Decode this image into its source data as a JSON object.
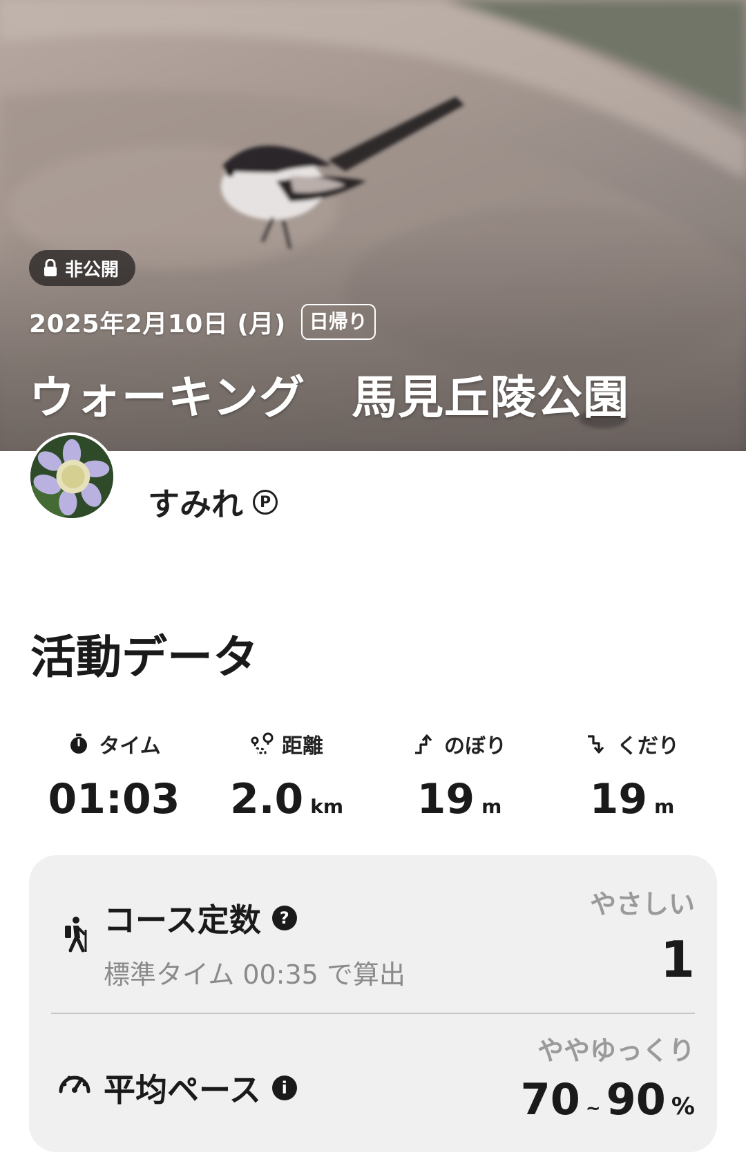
{
  "hero": {
    "privacy_label": "非公開",
    "date": "2025年2月10日 (月)",
    "trip_type": "日帰り",
    "title": "ウォーキング　馬見丘陵公園"
  },
  "user": {
    "name": "すみれ",
    "premium_mark": "P"
  },
  "activity": {
    "section_title": "活動データ",
    "stats": [
      {
        "icon": "stopwatch-icon",
        "label": "タイム",
        "value": "01:03",
        "unit": ""
      },
      {
        "icon": "route-icon",
        "label": "距離",
        "value": "2.0",
        "unit": "km"
      },
      {
        "icon": "ascent-icon",
        "label": "のぼり",
        "value": "19",
        "unit": "m"
      },
      {
        "icon": "descent-icon",
        "label": "くだり",
        "value": "19",
        "unit": "m"
      }
    ]
  },
  "course": {
    "icon": "hiker-icon",
    "title": "コース定数",
    "help": "?",
    "subtitle": "標準タイム 00:35 で算出",
    "difficulty": "やさしい",
    "value": "1"
  },
  "pace": {
    "icon": "speedometer-icon",
    "title": "平均ペース",
    "info": "i",
    "rating": "ややゆっくり",
    "min": "70",
    "tilde": "~",
    "max": "90",
    "unit": "%"
  }
}
